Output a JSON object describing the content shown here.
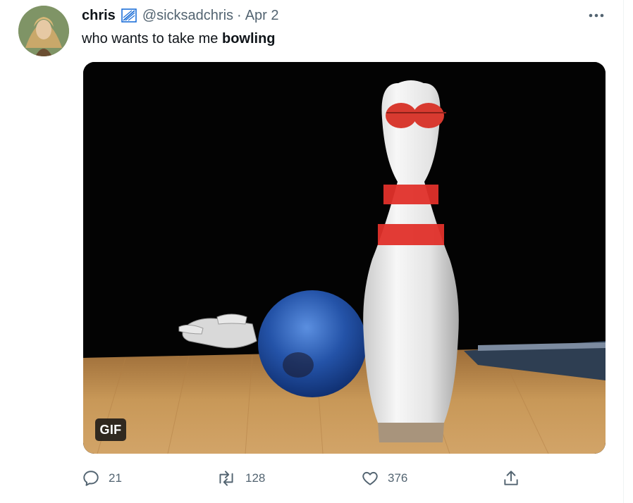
{
  "tweet": {
    "author": {
      "display_name": "chris",
      "handle": "@sicksadchris",
      "verified_icon": "verified-badge-icon"
    },
    "separator": "·",
    "date": "Apr 2",
    "text_prefix": "who wants to take me ",
    "text_bold": "bowling",
    "media": {
      "type": "gif",
      "badge_label": "GIF"
    },
    "actions": {
      "reply_count": "21",
      "retweet_count": "128",
      "like_count": "376"
    }
  },
  "colors": {
    "text_primary": "#0f1419",
    "text_secondary": "#536471",
    "pin_red": "#e0302a"
  },
  "icons": [
    "more-icon",
    "reply-icon",
    "retweet-icon",
    "like-icon",
    "share-icon"
  ]
}
